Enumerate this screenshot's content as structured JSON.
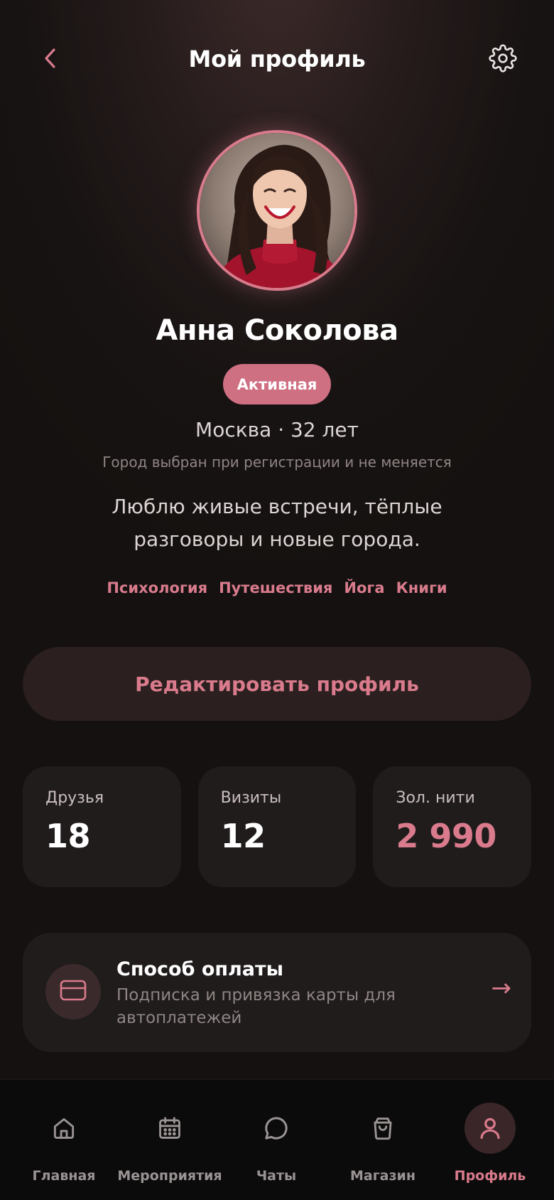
{
  "header": {
    "title": "Мой профиль",
    "back_icon": "chevron-left-icon",
    "settings_icon": "gear-icon"
  },
  "profile": {
    "name": "Анна Соколова",
    "status": "Активная",
    "location": "Москва · 32 лет",
    "location_note": "Город выбран при регистрации и не меняется",
    "bio": "Люблю живые встречи, тёплые разговоры и новые города.",
    "tags": [
      "Психология",
      "Путешествия",
      "Йога",
      "Книги"
    ]
  },
  "actions": {
    "edit_label": "Редактировать профиль"
  },
  "stats": [
    {
      "label": "Друзья",
      "value": "18"
    },
    {
      "label": "Визиты",
      "value": "12"
    },
    {
      "label": "Зол. нити",
      "value": "2 990"
    }
  ],
  "payment": {
    "title": "Способ оплаты",
    "subtitle": "Подписка и привязка карты для автоплатежей",
    "icon": "credit-card-icon",
    "arrow": "→"
  },
  "nav": {
    "items": [
      {
        "label": "Главная",
        "icon": "home-icon"
      },
      {
        "label": "Мероприятия",
        "icon": "calendar-icon"
      },
      {
        "label": "Чаты",
        "icon": "chat-bubble-icon"
      },
      {
        "label": "Магазин",
        "icon": "shopping-bag-icon"
      },
      {
        "label": "Профиль",
        "icon": "user-icon"
      }
    ],
    "active_index": 4
  },
  "colors": {
    "accent": "#d97b8c",
    "background": "#151211",
    "card": "#201c1c"
  }
}
